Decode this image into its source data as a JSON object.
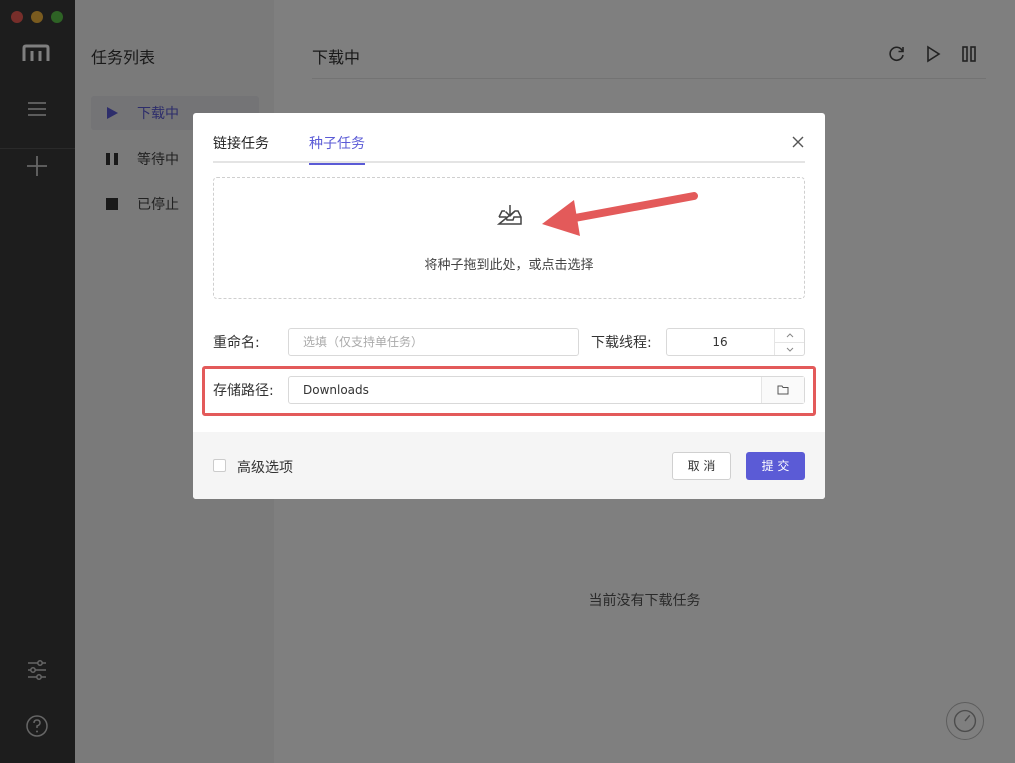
{
  "app": {
    "traffic_colors": [
      "#ee5d54",
      "#f4b63f",
      "#5cc74a"
    ],
    "accent": "#5b5bd6",
    "annotation_color": "#e35a5a"
  },
  "sidebar": {
    "icons": [
      "menu-icon",
      "add-icon",
      "settings-icon",
      "help-icon"
    ]
  },
  "tasklist": {
    "title": "任务列表",
    "items": [
      {
        "label": "下载中",
        "icon": "play-icon",
        "active": true
      },
      {
        "label": "等待中",
        "icon": "pause-icon",
        "active": false
      },
      {
        "label": "已停止",
        "icon": "stop-icon",
        "active": false
      }
    ]
  },
  "main": {
    "title": "下载中",
    "empty_text": "当前没有下载任务",
    "toolbar_icons": [
      "refresh-icon",
      "resume-all-icon",
      "pause-all-icon"
    ]
  },
  "dialog": {
    "tabs": [
      {
        "label": "链接任务",
        "active": false
      },
      {
        "label": "种子任务",
        "active": true
      }
    ],
    "drop_hint": "将种子拖到此处，或点击选择",
    "rename_label": "重命名:",
    "rename_placeholder": "选填（仅支持单任务）",
    "threads_label": "下载线程:",
    "threads_value": "16",
    "path_label": "存储路径:",
    "path_value": "Downloads",
    "advanced_label": "高级选项",
    "advanced_checked": false,
    "cancel_label": "取 消",
    "submit_label": "提 交"
  }
}
